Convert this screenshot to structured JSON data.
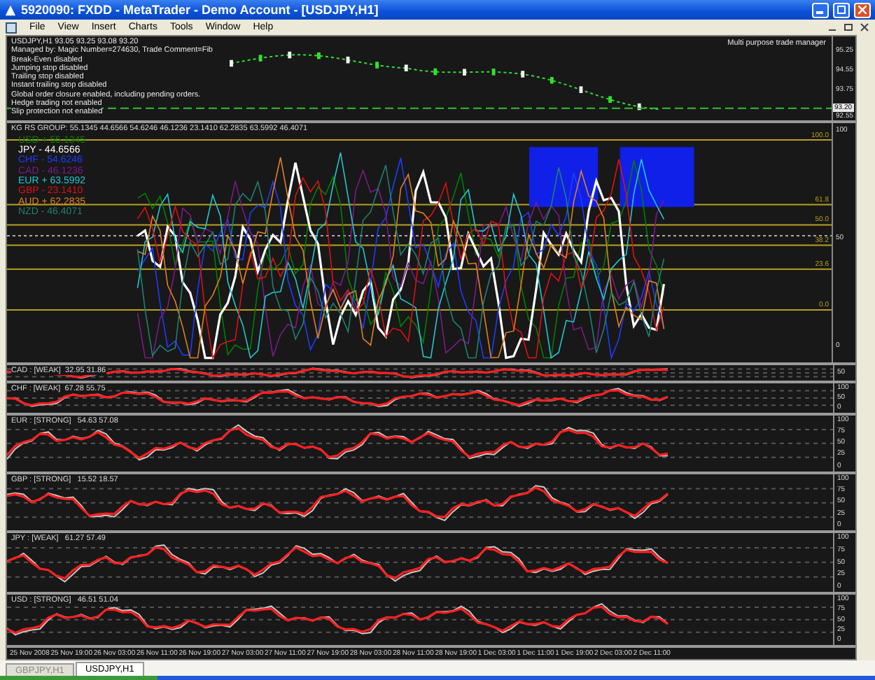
{
  "window": {
    "title": "5920090: FXDD - MetaTrader - Demo Account - [USDJPY,H1]"
  },
  "menu": [
    "File",
    "View",
    "Insert",
    "Charts",
    "Tools",
    "Window",
    "Help"
  ],
  "price_chart": {
    "info_lines": [
      "USDJPY,H1  93.05 93.25 93.08 93.20",
      "Managed by: Magic Number=274630, Trade Comment=Fib",
      "Break-Even disabled",
      "Jumping stop disabled",
      "Trailing stop disabled",
      "Instant trailing stop disabled",
      "Global order closure enabled, including pending orders.",
      "Hedge trading not enabled",
      "Slip protection not enabled"
    ],
    "trade_manager": "Multi purpose trade manager",
    "price_scale": [
      "95.25",
      "94.55",
      "93.75"
    ],
    "current_price": "93.20",
    "low_price": "92.55"
  },
  "strength_group": {
    "header": "KG RS GROUP: 55.1345 44.6566 54.6246 46.1236 23.1410 62.2835 63.5992 46.4071",
    "currencies": [
      {
        "label": "USD + 55.1345",
        "color": "#008000"
      },
      {
        "label": "JPY - 44.6566",
        "color": "#ffffff"
      },
      {
        "label": "CHF - 54.6246",
        "color": "#1e3cff"
      },
      {
        "label": "CAD - 46.1236",
        "color": "#7a1a8a"
      },
      {
        "label": "EUR + 63.5992",
        "color": "#20c8d0"
      },
      {
        "label": "GBP - 23.1410",
        "color": "#e01010"
      },
      {
        "label": "AUD + 62.2835",
        "color": "#e08020"
      },
      {
        "label": "NZD - 46.4071",
        "color": "#208070"
      }
    ],
    "levels": [
      "100.0",
      "61.8",
      "50.0",
      "38.2",
      "23.6",
      "0.0"
    ],
    "scale": [
      "100",
      "50",
      "0"
    ]
  },
  "currency_panels": [
    {
      "header": "CAD : [WEAK]  32.95 31.86",
      "scale": [
        "50"
      ]
    },
    {
      "header": "CHF : [WEAK]  67.28 55.75",
      "scale": [
        "100",
        "50",
        "0"
      ]
    },
    {
      "header": "EUR : [STRONG]   54.63 57.08",
      "scale": [
        "100",
        "75",
        "50",
        "25",
        "0"
      ]
    },
    {
      "header": "GBP : [STRONG]   15.52 18.57",
      "scale": [
        "100",
        "75",
        "50",
        "25",
        "0"
      ]
    },
    {
      "header": "JPY : [WEAK]   61.27 57.49",
      "scale": [
        "100",
        "75",
        "50",
        "25",
        "0"
      ]
    },
    {
      "header": "USD : [STRONG]   46.51 51.04",
      "scale": [
        "100",
        "75",
        "50",
        "25",
        "0"
      ]
    }
  ],
  "time_axis": [
    "25 Nov 2008",
    "25 Nov 19:00",
    "26 Nov 03:00",
    "26 Nov 11:00",
    "26 Nov 19:00",
    "27 Nov 03:00",
    "27 Nov 11:00",
    "27 Nov 19:00",
    "28 Nov 03:00",
    "28 Nov 11:00",
    "28 Nov 19:00",
    "1 Dec 03:00",
    "1 Dec 11:00",
    "1 Dec 19:00",
    "2 Dec 03:00",
    "2 Dec 11:00"
  ],
  "chart_tabs": [
    {
      "label": "GBPJPY,H1",
      "selected": false
    },
    {
      "label": "USDJPY,H1",
      "selected": true
    }
  ]
}
